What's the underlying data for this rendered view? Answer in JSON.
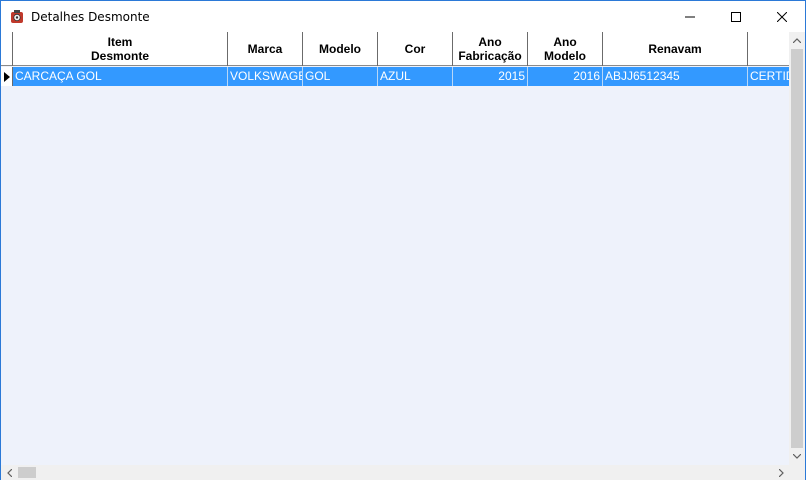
{
  "window": {
    "title": "Detalhes Desmonte",
    "icon": "dismantle-app-icon"
  },
  "grid": {
    "columns": [
      {
        "key": "item",
        "label": "Item\nDesmonte"
      },
      {
        "key": "marca",
        "label": "Marca"
      },
      {
        "key": "modelo",
        "label": "Modelo"
      },
      {
        "key": "cor",
        "label": "Cor"
      },
      {
        "key": "ano_fab",
        "label": "Ano\nFabricação"
      },
      {
        "key": "ano_mod",
        "label": "Ano\nModelo"
      },
      {
        "key": "renavam",
        "label": "Renavam"
      },
      {
        "key": "extra",
        "label": ""
      }
    ],
    "rows": [
      {
        "selected": true,
        "item": "CARCAÇA GOL",
        "marca": "VOLKSWAGEN",
        "modelo": "GOL",
        "cor": "AZUL",
        "ano_fab": "2015",
        "ano_mod": "2016",
        "renavam": "ABJJ6512345",
        "extra": "CERTIDÃO"
      }
    ]
  },
  "colors": {
    "selection": "#3399ff",
    "grid_background": "#eef2fb",
    "window_border": "#2b79d7"
  }
}
